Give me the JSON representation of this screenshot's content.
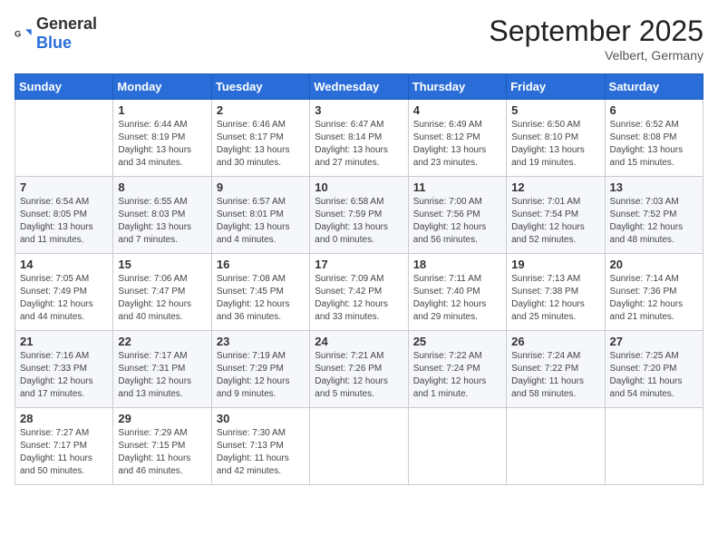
{
  "logo": {
    "general": "General",
    "blue": "Blue"
  },
  "title": "September 2025",
  "location": "Velbert, Germany",
  "days_of_week": [
    "Sunday",
    "Monday",
    "Tuesday",
    "Wednesday",
    "Thursday",
    "Friday",
    "Saturday"
  ],
  "weeks": [
    [
      {
        "day": "",
        "content": ""
      },
      {
        "day": "1",
        "content": "Sunrise: 6:44 AM\nSunset: 8:19 PM\nDaylight: 13 hours and 34 minutes."
      },
      {
        "day": "2",
        "content": "Sunrise: 6:46 AM\nSunset: 8:17 PM\nDaylight: 13 hours and 30 minutes."
      },
      {
        "day": "3",
        "content": "Sunrise: 6:47 AM\nSunset: 8:14 PM\nDaylight: 13 hours and 27 minutes."
      },
      {
        "day": "4",
        "content": "Sunrise: 6:49 AM\nSunset: 8:12 PM\nDaylight: 13 hours and 23 minutes."
      },
      {
        "day": "5",
        "content": "Sunrise: 6:50 AM\nSunset: 8:10 PM\nDaylight: 13 hours and 19 minutes."
      },
      {
        "day": "6",
        "content": "Sunrise: 6:52 AM\nSunset: 8:08 PM\nDaylight: 13 hours and 15 minutes."
      }
    ],
    [
      {
        "day": "7",
        "content": "Sunrise: 6:54 AM\nSunset: 8:05 PM\nDaylight: 13 hours and 11 minutes."
      },
      {
        "day": "8",
        "content": "Sunrise: 6:55 AM\nSunset: 8:03 PM\nDaylight: 13 hours and 7 minutes."
      },
      {
        "day": "9",
        "content": "Sunrise: 6:57 AM\nSunset: 8:01 PM\nDaylight: 13 hours and 4 minutes."
      },
      {
        "day": "10",
        "content": "Sunrise: 6:58 AM\nSunset: 7:59 PM\nDaylight: 13 hours and 0 minutes."
      },
      {
        "day": "11",
        "content": "Sunrise: 7:00 AM\nSunset: 7:56 PM\nDaylight: 12 hours and 56 minutes."
      },
      {
        "day": "12",
        "content": "Sunrise: 7:01 AM\nSunset: 7:54 PM\nDaylight: 12 hours and 52 minutes."
      },
      {
        "day": "13",
        "content": "Sunrise: 7:03 AM\nSunset: 7:52 PM\nDaylight: 12 hours and 48 minutes."
      }
    ],
    [
      {
        "day": "14",
        "content": "Sunrise: 7:05 AM\nSunset: 7:49 PM\nDaylight: 12 hours and 44 minutes."
      },
      {
        "day": "15",
        "content": "Sunrise: 7:06 AM\nSunset: 7:47 PM\nDaylight: 12 hours and 40 minutes."
      },
      {
        "day": "16",
        "content": "Sunrise: 7:08 AM\nSunset: 7:45 PM\nDaylight: 12 hours and 36 minutes."
      },
      {
        "day": "17",
        "content": "Sunrise: 7:09 AM\nSunset: 7:42 PM\nDaylight: 12 hours and 33 minutes."
      },
      {
        "day": "18",
        "content": "Sunrise: 7:11 AM\nSunset: 7:40 PM\nDaylight: 12 hours and 29 minutes."
      },
      {
        "day": "19",
        "content": "Sunrise: 7:13 AM\nSunset: 7:38 PM\nDaylight: 12 hours and 25 minutes."
      },
      {
        "day": "20",
        "content": "Sunrise: 7:14 AM\nSunset: 7:36 PM\nDaylight: 12 hours and 21 minutes."
      }
    ],
    [
      {
        "day": "21",
        "content": "Sunrise: 7:16 AM\nSunset: 7:33 PM\nDaylight: 12 hours and 17 minutes."
      },
      {
        "day": "22",
        "content": "Sunrise: 7:17 AM\nSunset: 7:31 PM\nDaylight: 12 hours and 13 minutes."
      },
      {
        "day": "23",
        "content": "Sunrise: 7:19 AM\nSunset: 7:29 PM\nDaylight: 12 hours and 9 minutes."
      },
      {
        "day": "24",
        "content": "Sunrise: 7:21 AM\nSunset: 7:26 PM\nDaylight: 12 hours and 5 minutes."
      },
      {
        "day": "25",
        "content": "Sunrise: 7:22 AM\nSunset: 7:24 PM\nDaylight: 12 hours and 1 minute."
      },
      {
        "day": "26",
        "content": "Sunrise: 7:24 AM\nSunset: 7:22 PM\nDaylight: 11 hours and 58 minutes."
      },
      {
        "day": "27",
        "content": "Sunrise: 7:25 AM\nSunset: 7:20 PM\nDaylight: 11 hours and 54 minutes."
      }
    ],
    [
      {
        "day": "28",
        "content": "Sunrise: 7:27 AM\nSunset: 7:17 PM\nDaylight: 11 hours and 50 minutes."
      },
      {
        "day": "29",
        "content": "Sunrise: 7:29 AM\nSunset: 7:15 PM\nDaylight: 11 hours and 46 minutes."
      },
      {
        "day": "30",
        "content": "Sunrise: 7:30 AM\nSunset: 7:13 PM\nDaylight: 11 hours and 42 minutes."
      },
      {
        "day": "",
        "content": ""
      },
      {
        "day": "",
        "content": ""
      },
      {
        "day": "",
        "content": ""
      },
      {
        "day": "",
        "content": ""
      }
    ]
  ]
}
